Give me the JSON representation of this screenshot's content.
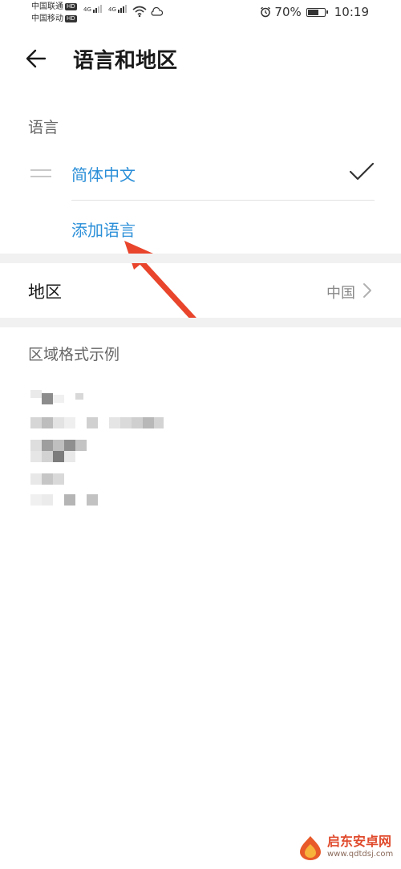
{
  "status_bar": {
    "carrier_1": "中国联通",
    "carrier_2": "中国移动",
    "hd_badge": "HD",
    "network_1": "4G",
    "network_2": "4G",
    "battery_percent": "70%",
    "battery_level": 0.7,
    "time": "10:19"
  },
  "header": {
    "title": "语言和地区",
    "back_icon": "arrow-left-icon"
  },
  "language_section": {
    "label": "语言",
    "languages": [
      {
        "name": "简体中文",
        "selected": true
      }
    ],
    "add_language_label": "添加语言"
  },
  "region": {
    "label": "地区",
    "value": "中国"
  },
  "format_section": {
    "label": "区域格式示例"
  },
  "watermark": {
    "text_cn": "启东安卓网",
    "url": "www.qdtdsj.com"
  },
  "colors": {
    "accent": "#2b8fd8",
    "annotation_arrow": "#e8452c"
  }
}
